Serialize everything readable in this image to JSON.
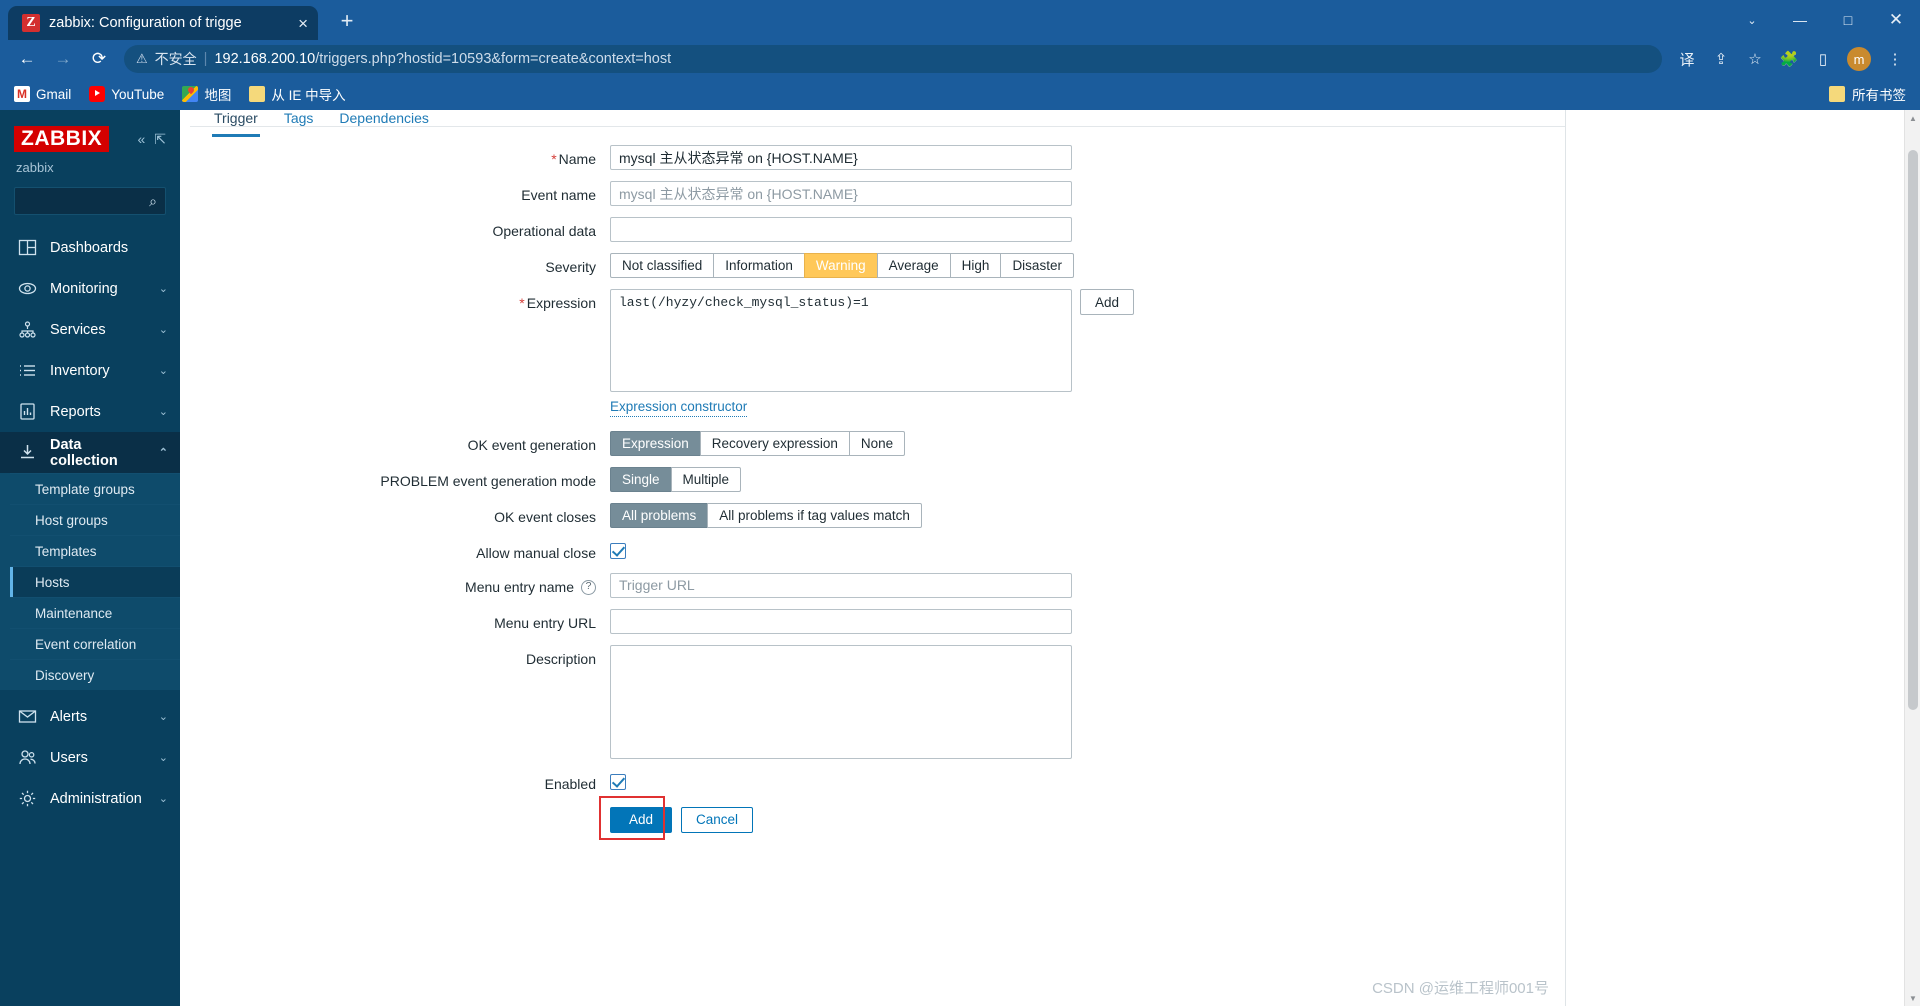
{
  "browser": {
    "tab": {
      "title": "zabbix: Configuration of trigge",
      "favicon_letter": "Z",
      "close_icon": "×"
    },
    "new_tab_icon": "+",
    "window_controls": {
      "minimize": "—",
      "maximize": "□",
      "close": "✕",
      "chevron": "⌄"
    },
    "nav": {
      "back_icon": "←",
      "forward_icon": "→",
      "reload_icon": "⟳"
    },
    "omnibox": {
      "warning_icon": "⚠",
      "insecure_label": "不安全",
      "separator": "|",
      "host": "192.168.200.10",
      "path": "/triggers.php?hostid=10593&form=create&context=host"
    },
    "toolbar_icons": {
      "translate": "译",
      "share": "⇪",
      "bookmark_star": "☆",
      "extensions": "🧩",
      "sidepanel": "▯",
      "profile_letter": "m",
      "menu": "⋮"
    },
    "bookmarks": [
      {
        "label": "Gmail",
        "icon": "gmail-icon"
      },
      {
        "label": "YouTube",
        "icon": "youtube-icon"
      },
      {
        "label": "地图",
        "icon": "google-maps-icon"
      },
      {
        "label": "从 IE 中导入",
        "icon": "folder-icon"
      }
    ],
    "bookmarks_right": {
      "label": "所有书签",
      "icon": "folder-icon",
      "chevron": "»"
    }
  },
  "sidebar": {
    "logo": "ZABBIX",
    "collapse_icon": "«",
    "expand_icon": "⇱",
    "user": "zabbix",
    "search_placeholder": "",
    "search_value": "",
    "search_icon": "⌕",
    "nav": [
      {
        "label": "Dashboards",
        "icon": "dashboard-icon",
        "chevron": ""
      },
      {
        "label": "Monitoring",
        "icon": "eye-icon",
        "chevron": "⌄"
      },
      {
        "label": "Services",
        "icon": "services-tree-icon",
        "chevron": "⌄"
      },
      {
        "label": "Inventory",
        "icon": "list-icon",
        "chevron": "⌄"
      },
      {
        "label": "Reports",
        "icon": "report-chart-icon",
        "chevron": "⌄"
      },
      {
        "label": "Data collection",
        "icon": "download-icon",
        "chevron": "⌃"
      }
    ],
    "submenu": [
      {
        "label": "Template groups",
        "active": false
      },
      {
        "label": "Host groups",
        "active": false
      },
      {
        "label": "Templates",
        "active": false
      },
      {
        "label": "Hosts",
        "active": true
      },
      {
        "label": "Maintenance",
        "active": false
      },
      {
        "label": "Event correlation",
        "active": false
      },
      {
        "label": "Discovery",
        "active": false
      }
    ],
    "nav_bottom": [
      {
        "label": "Alerts",
        "icon": "envelope-icon",
        "chevron": "⌄"
      },
      {
        "label": "Users",
        "icon": "users-icon",
        "chevron": "⌄"
      },
      {
        "label": "Administration",
        "icon": "gear-icon",
        "chevron": "⌄"
      }
    ]
  },
  "form": {
    "tabs": [
      {
        "label": "Trigger",
        "active": true
      },
      {
        "label": "Tags",
        "active": false
      },
      {
        "label": "Dependencies",
        "active": false
      }
    ],
    "name": {
      "label": "Name",
      "required": "*",
      "value": "mysql 主从状态异常 on {HOST.NAME}",
      "placeholder": ""
    },
    "event_name": {
      "label": "Event name",
      "value": "",
      "placeholder": "mysql 主从状态异常 on {HOST.NAME}"
    },
    "operational_data": {
      "label": "Operational data",
      "value": "",
      "placeholder": ""
    },
    "severity": {
      "label": "Severity",
      "options": [
        "Not classified",
        "Information",
        "Warning",
        "Average",
        "High",
        "Disaster"
      ],
      "selected": "Warning"
    },
    "expression": {
      "label": "Expression",
      "required": "*",
      "value": "last(/hyzy/check_mysql_status)=1",
      "add_button": "Add",
      "constructor_link": "Expression constructor"
    },
    "ok_event_generation": {
      "label": "OK event generation",
      "options": [
        "Expression",
        "Recovery expression",
        "None"
      ],
      "selected": "Expression"
    },
    "problem_event_generation_mode": {
      "label": "PROBLEM event generation mode",
      "options": [
        "Single",
        "Multiple"
      ],
      "selected": "Single"
    },
    "ok_event_closes": {
      "label": "OK event closes",
      "options": [
        "All problems",
        "All problems if tag values match"
      ],
      "selected": "All problems"
    },
    "allow_manual_close": {
      "label": "Allow manual close",
      "checked": true
    },
    "menu_entry_name": {
      "label": "Menu entry name",
      "help_icon": "?",
      "value": "",
      "placeholder": "Trigger URL"
    },
    "menu_entry_url": {
      "label": "Menu entry URL",
      "value": "",
      "placeholder": ""
    },
    "description": {
      "label": "Description",
      "value": "",
      "placeholder": ""
    },
    "enabled": {
      "label": "Enabled",
      "checked": true
    },
    "actions": {
      "submit": "Add",
      "cancel": "Cancel"
    }
  },
  "watermark": "CSDN @运维工程师001号"
}
